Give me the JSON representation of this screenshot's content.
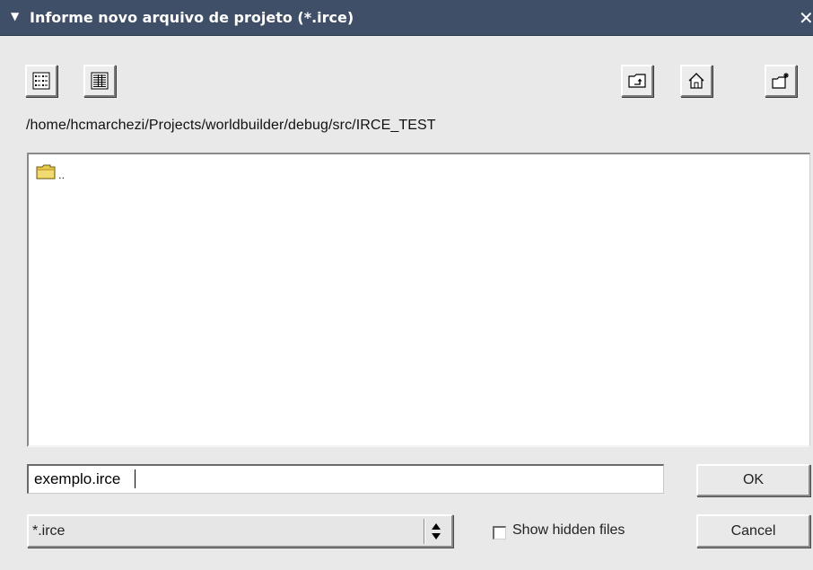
{
  "window": {
    "title": "Informe novo arquivo de projeto (*.irce)",
    "menu_icon": "triangle-down-icon",
    "close_icon": "close-x-icon"
  },
  "toolbar": {
    "left_buttons": [
      {
        "name": "list-view",
        "icon": "list-view-icon"
      },
      {
        "name": "detail-view",
        "icon": "detail-view-icon"
      }
    ],
    "right_buttons": [
      {
        "name": "parent-directory",
        "icon": "folder-up-icon"
      },
      {
        "name": "home",
        "icon": "home-icon"
      },
      {
        "name": "new-folder",
        "icon": "new-folder-icon"
      }
    ]
  },
  "path": "/home/hcmarchezi/Projects/worldbuilder/debug/src/IRCE_TEST",
  "files": [
    {
      "name": "..",
      "icon": "folder-icon"
    }
  ],
  "filename": {
    "value": "exemplo.irce"
  },
  "buttons": {
    "ok": "OK",
    "cancel": "Cancel"
  },
  "filter": {
    "selected": "*.irce"
  },
  "show_hidden": {
    "label": "Show hidden files",
    "checked": false
  },
  "colors": {
    "titlebar": "#3f4f67",
    "background": "#e9e9e9"
  }
}
